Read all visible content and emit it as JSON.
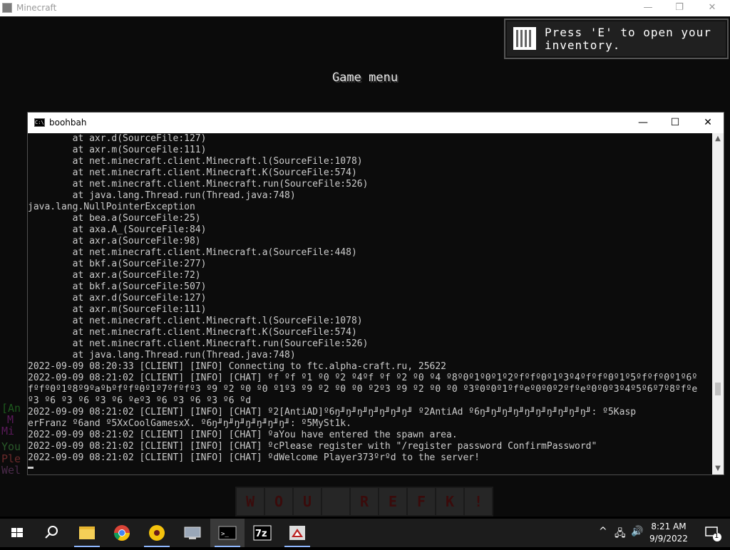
{
  "mc_window": {
    "title": "Minecraft",
    "controls": {
      "minimize": "—",
      "restore": "❐",
      "close": "✕"
    },
    "game_menu_title": "Game menu",
    "toast": "Press 'E' to open your inventory.",
    "chat_fragments": [
      "[An",
      "M",
      "Mi",
      "You",
      "Ple",
      "Wel"
    ],
    "hotbar": [
      "W",
      "O",
      "U",
      "",
      "R",
      "E",
      "F",
      "K",
      "!"
    ]
  },
  "console_window": {
    "title": "boohbah",
    "controls": {
      "minimize": "—",
      "maximize": "☐",
      "close": "✕"
    },
    "lines": [
      "        at axr.d(SourceFile:127)",
      "        at axr.m(SourceFile:111)",
      "        at net.minecraft.client.Minecraft.l(SourceFile:1078)",
      "        at net.minecraft.client.Minecraft.K(SourceFile:574)",
      "        at net.minecraft.client.Minecraft.run(SourceFile:526)",
      "        at java.lang.Thread.run(Thread.java:748)",
      "java.lang.NullPointerException",
      "        at bea.a(SourceFile:25)",
      "        at axa.A_(SourceFile:84)",
      "        at axr.a(SourceFile:98)",
      "        at net.minecraft.client.Minecraft.a(SourceFile:448)",
      "        at bkf.a(SourceFile:277)",
      "        at axr.a(SourceFile:72)",
      "        at bkf.a(SourceFile:507)",
      "        at axr.d(SourceFile:127)",
      "        at axr.m(SourceFile:111)",
      "        at net.minecraft.client.Minecraft.l(SourceFile:1078)",
      "        at net.minecraft.client.Minecraft.K(SourceFile:574)",
      "        at net.minecraft.client.Minecraft.run(SourceFile:526)",
      "        at java.lang.Thread.run(Thread.java:748)",
      "2022-09-09 08:20:33 [CLIENT] [INFO] Connecting to ftc.alpha-craft.ru, 25622",
      "2022-09-09 08:21:02 [CLIENT] [INFO] [CHAT] ºf ºf º1 º0 º2 º4ºf ºf º2 º0 º4 º8º0º1º0º1º2ºfºfº0º1º3º4ºfºfº0º1º5ºfºfº0º1º6º",
      "fºfº0º1º8º9ºaºbºfºfº0º1º7ºfºfº3 º9 º2 º0 º0 º1º3 º9 º2 º0 º0 º2º3 º9 º2 º0 º0 º3º0º0º1ºfºeº0º0º2ºfºeº0º0º3º4º5º6º7º8ºfºe",
      "º3 º6 º3 º6 º3 º6 ºeº3 º6 º3 º6 º3 º6 ºd",
      "2022-09-09 08:21:02 [CLIENT] [INFO] [CHAT] º2[AntiAD]º6ŋ╜ŋ╜ŋ╜ŋ╜ŋ╜ŋ╜ŋ╜ º2AntiAd º6ŋ╜ŋ╜ŋ╜ŋ╜ŋ╜ŋ╜ŋ╜ŋ╜ŋ╜ŋ╜: º5Kasp",
      "erFranz º6and º5XxCoolGamesxX. º6ŋ╜ŋ╜ŋ╜ŋ╜ŋ╜ŋ╜ŋ╜: º5MySt1k.",
      "2022-09-09 08:21:02 [CLIENT] [INFO] [CHAT] ºaYou have entered the spawn area.",
      "2022-09-09 08:21:02 [CLIENT] [INFO] [CHAT] ºcPlease register with \"/register password ConfirmPassword\"",
      "2022-09-09 08:21:02 [CLIENT] [INFO] [CHAT] ºdWelcome Player373ºrºd to the server!"
    ]
  },
  "taskbar": {
    "apps": [
      {
        "name": "start-icon",
        "glyph": "⊞"
      },
      {
        "name": "search-icon",
        "glyph": "⚲"
      },
      {
        "name": "file-explorer-icon",
        "glyph": "▬"
      },
      {
        "name": "chrome-icon",
        "glyph": "◉"
      },
      {
        "name": "yellow-app-icon",
        "glyph": "●"
      },
      {
        "name": "network-app-icon",
        "glyph": "▣"
      },
      {
        "name": "command-prompt-icon",
        "glyph": ">_"
      },
      {
        "name": "7zip-icon",
        "glyph": "7z"
      },
      {
        "name": "java-app-icon",
        "glyph": "✦"
      }
    ],
    "tray": {
      "chevron": "^",
      "network": "🖧",
      "volume": "🔊"
    },
    "time": "8:21 AM",
    "date": "9/9/2022",
    "notifications_count": "1",
    "colors": {
      "chrome_red": "#db4437",
      "chrome_yellow": "#f4c20d",
      "chrome_green": "#0f9d58",
      "folder": "#e6b530",
      "accent": "#8fb8ff"
    }
  }
}
